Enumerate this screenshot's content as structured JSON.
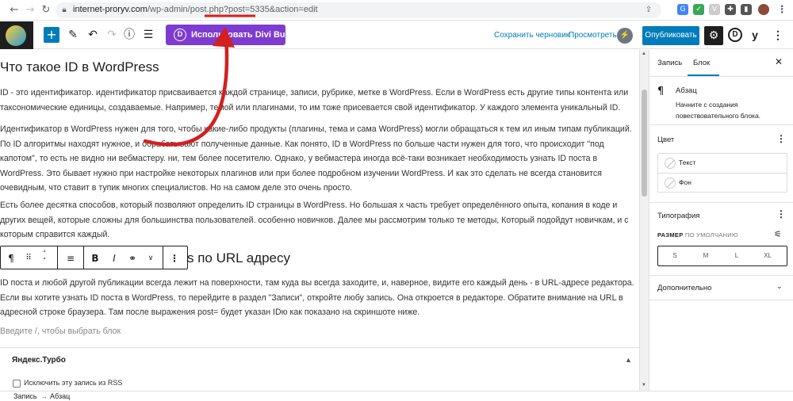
{
  "browser": {
    "back_icon": "arrow-left-icon",
    "forward_icon": "arrow-right-icon",
    "reload_icon": "reload-icon",
    "url_host": "internet-proryv.com",
    "url_path": "/wp-admin/post.php?post=5335&action=edit"
  },
  "toolbar": {
    "divi_label": "Использовать Divi Builder",
    "save_draft": "Сохранить черновик",
    "preview": "Просмотреть",
    "publish": "Опубликовать",
    "divi_icon_letter": "D",
    "yoast_letter": "y"
  },
  "content": {
    "title": "Что такое ID в WordPress",
    "p1": "ID - это идентификатор. идентификатор присваивается каждой странице, записи, рубрике, метке в WordPress. Если в WordPress есть другие типы контента или таксономические единицы, создаваемые. Например, темой или плагинами, то им тоже присевается свой идентификатор. У каждого элемента уникальный ID.",
    "p2": "Идентификатор в WordPress нужен для того, чтобы какие-либо продукты (плагины, тема и сама WordPress) могли обращаться к тем ил иным типам публикаций. По ID алгоритмы находят нужное, и обрабатывают полученные данные. Как понято, ID в WordPress по больше части нужен для того, что происходит \"под капотом\", то есть не видно ни вебмастеру. ни, тем более посетителю. Однако, у вебмастера иногда всё-таки возникает необходимость  узнать ID поста в WordPress. Это бывает нужно при настройке некоторых плагинов или при более подробном изучении WordPress. И как это сделать не всегда становится очевидным, что ставит в тупик многих специалистов. Но на самом деле это очень просто.",
    "p3": "Есть более десятка способов, который позволяют определить ID страницы в WordPress. Но большая х часть требует определённого опыта, копания в коде и других вещей, которые сложны для большинства пользователей. особенно новичков. Далее мы рассмотрим только те методы, Который подойдут новичкам, и с которым справится каждый.",
    "heading2": "s по URL адресу",
    "p4": "ID поста и любой другой публикации всегда лежит на поверхности, там куда вы всегда заходите, и, наверное, видите его каждый день - в URL-адресе редактора. Если вы хотите узнать ID поста в WordPress, то перейдите в раздел \"Записи\", откройте любу запись. Она откроется в редакторе. Обратите внимание на URL в адресной строке браузера. Там после выражения post= будет указан IDю как показано на скриншоте ниже.",
    "placeholder": "Введите /, чтобы выбрать блок"
  },
  "metabox": {
    "title": "Яндекс.Турбо",
    "rss_label": "Исключить эту запись из RSS",
    "rss_checked": false
  },
  "statusbar": {
    "crumb1": "Запись",
    "sep": "→",
    "crumb2": "Абзац"
  },
  "sidebar": {
    "tab_post": "Запись",
    "tab_block": "Блок",
    "block_name": "Абзац",
    "block_desc": "Начните с создания повествовательного блока.",
    "color_title": "Цвет",
    "color_text": "Текст",
    "color_bg": "Фон",
    "typo_title": "Типография",
    "size_label_strong": "РАЗМЕР",
    "size_label_rest": " ПО УМОЛЧАНИЮ",
    "sizes": [
      "S",
      "M",
      "L",
      "XL"
    ],
    "advanced": "Дополнительно"
  },
  "colors": {
    "accent": "#007cba",
    "divi": "#7e3bd0",
    "annotation": "#d32020"
  }
}
